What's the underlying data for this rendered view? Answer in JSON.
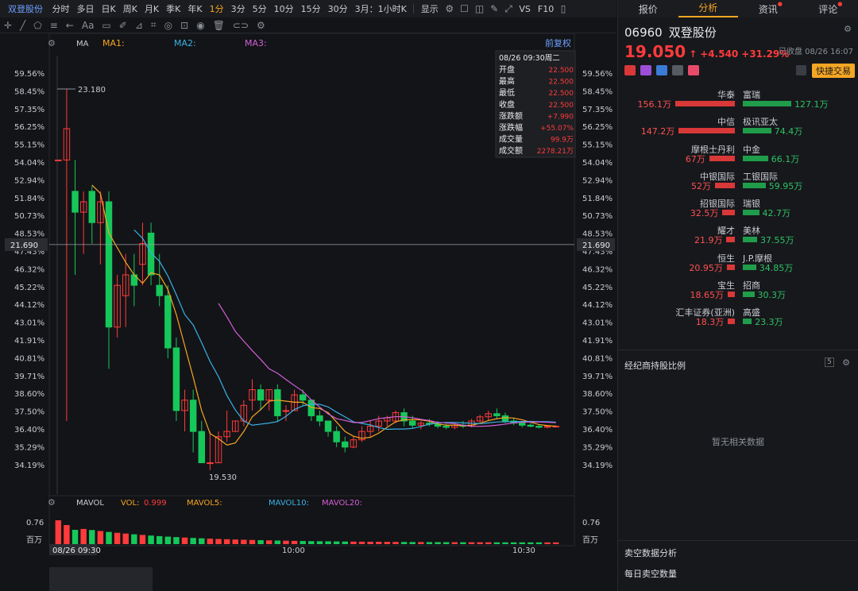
{
  "topbar": {
    "stock_name": "双登股份",
    "intervals": [
      "分时",
      "多日",
      "日K",
      "周K",
      "月K",
      "季K",
      "年K",
      "1分",
      "3分",
      "5分",
      "10分",
      "15分",
      "30分"
    ],
    "active_interval": "1分",
    "range": "3月：1小时K",
    "display": "显示",
    "vs": "VS",
    "f10": "F10"
  },
  "toolbar": {
    "icons": [
      "crosshair-icon",
      "line-icon",
      "shape-icon",
      "fib-icon",
      "arrow-icon",
      "text-icon",
      "note-icon",
      "pen-icon",
      "ruler-icon",
      "measure-icon",
      "magnet-icon",
      "lock-icon",
      "eye-icon",
      "trash-icon",
      "link-icon",
      "settings-icon"
    ]
  },
  "chart": {
    "ma_label": "MA",
    "ma1": "MA1:",
    "ma2": "MA2:",
    "ma3": "MA3:",
    "fuquan": "前复权",
    "high_label": "23.180",
    "low_label": "19.530",
    "cross_price": "21.690",
    "left_axis": [
      "59.56%",
      "58.45%",
      "57.35%",
      "56.25%",
      "55.15%",
      "54.04%",
      "52.94%",
      "51.84%",
      "50.73%",
      "48.53%",
      "47.43%",
      "46.32%",
      "45.22%",
      "44.12%",
      "43.01%",
      "41.91%",
      "40.81%",
      "39.71%",
      "38.60%",
      "37.50%",
      "36.40%",
      "35.29%",
      "34.19%"
    ],
    "tooltip": {
      "date": "08/26 09:30周二",
      "rows": [
        [
          "开盘",
          "22.500"
        ],
        [
          "最高",
          "22.500"
        ],
        [
          "最低",
          "22.500"
        ],
        [
          "收盘",
          "22.500"
        ],
        [
          "涨跌额",
          "+7.990"
        ],
        [
          "涨跌幅",
          "+55.07%"
        ],
        [
          "成交量",
          "99.9万"
        ],
        [
          "成交额",
          "2278.21万"
        ]
      ]
    },
    "vol": {
      "label": "MAVOL",
      "vol": "VOL:",
      "vol_val": "0.999",
      "mavol5": "MAVOL5:",
      "mavol10": "MAVOL10:",
      "mavol20": "MAVOL20:",
      "scale": "0.76",
      "unit": "百万"
    },
    "time_labels": [
      "08/26 09:30",
      "10:00",
      "10:30"
    ],
    "colors": {
      "up": "#ff3b3b",
      "down": "#16c75a",
      "ma1": "#f5a623",
      "ma2": "#3ab0e6",
      "ma3": "#d45fd8"
    }
  },
  "chart_data": {
    "type": "candlestick",
    "candles": [
      [
        22.5,
        22.5,
        22.5,
        22.5
      ],
      [
        22.5,
        23.18,
        20.0,
        22.8
      ],
      [
        22.2,
        22.5,
        21.4,
        22.0
      ],
      [
        22.0,
        22.2,
        21.6,
        22.1
      ],
      [
        22.2,
        22.25,
        21.7,
        21.9
      ],
      [
        21.9,
        22.2,
        21.5,
        22.1
      ],
      [
        22.1,
        22.2,
        20.5,
        20.9
      ],
      [
        20.9,
        21.4,
        20.8,
        21.3
      ],
      [
        21.2,
        21.6,
        20.9,
        21.4
      ],
      [
        21.4,
        21.6,
        21.1,
        21.3
      ],
      [
        21.5,
        21.9,
        21.3,
        21.7
      ],
      [
        21.8,
        21.9,
        21.3,
        21.4
      ],
      [
        21.3,
        21.6,
        21.1,
        21.2
      ],
      [
        21.2,
        21.3,
        20.6,
        20.7
      ],
      [
        20.7,
        20.8,
        20.0,
        20.1
      ],
      [
        20.1,
        20.3,
        19.9,
        20.2
      ],
      [
        20.2,
        20.3,
        19.7,
        19.9
      ],
      [
        19.9,
        20.0,
        19.8,
        19.6
      ],
      [
        19.6,
        19.9,
        19.53,
        19.6
      ],
      [
        19.6,
        19.9,
        19.6,
        19.85
      ],
      [
        19.85,
        20.1,
        19.8,
        19.9
      ],
      [
        19.9,
        20.0,
        19.9,
        20.0
      ],
      [
        20.0,
        20.2,
        19.95,
        20.15
      ],
      [
        20.2,
        20.4,
        20.1,
        20.3
      ],
      [
        20.3,
        20.35,
        20.1,
        20.2
      ],
      [
        20.2,
        20.3,
        20.1,
        20.3
      ],
      [
        20.3,
        20.35,
        20.0,
        20.05
      ],
      [
        20.1,
        20.15,
        20.0,
        20.1
      ],
      [
        20.1,
        20.3,
        20.1,
        20.25
      ],
      [
        20.25,
        20.3,
        20.15,
        20.2
      ],
      [
        20.2,
        20.2,
        20.0,
        20.05
      ],
      [
        20.05,
        20.1,
        19.95,
        20.0
      ],
      [
        20.0,
        20.0,
        19.85,
        19.9
      ],
      [
        19.9,
        19.95,
        19.75,
        19.8
      ],
      [
        19.8,
        19.85,
        19.7,
        19.75
      ],
      [
        19.75,
        19.85,
        19.74,
        19.82
      ],
      [
        19.82,
        19.95,
        19.8,
        19.9
      ],
      [
        19.9,
        20.0,
        19.85,
        19.95
      ],
      [
        19.95,
        20.05,
        19.9,
        20.0
      ],
      [
        20.0,
        20.05,
        19.95,
        20.03
      ],
      [
        20.0,
        20.1,
        19.98,
        20.08
      ],
      [
        20.08,
        20.12,
        19.95,
        20.0
      ],
      [
        20.0,
        20.05,
        19.93,
        19.96
      ],
      [
        19.96,
        20.0,
        19.92,
        19.98
      ],
      [
        19.98,
        20.02,
        19.95,
        19.97
      ],
      [
        19.97,
        20.0,
        19.93,
        19.95
      ],
      [
        19.95,
        19.98,
        19.92,
        19.94
      ],
      [
        19.94,
        19.98,
        19.92,
        19.96
      ],
      [
        19.96,
        20.0,
        19.93,
        19.95
      ],
      [
        19.95,
        20.02,
        19.94,
        20.0
      ],
      [
        20.0,
        20.06,
        19.98,
        20.04
      ],
      [
        20.04,
        20.1,
        20.0,
        20.07
      ],
      [
        20.07,
        20.12,
        20.02,
        20.05
      ],
      [
        20.05,
        20.08,
        19.98,
        20.0
      ],
      [
        20.0,
        20.03,
        19.96,
        19.98
      ],
      [
        19.98,
        20.0,
        19.94,
        19.96
      ],
      [
        19.96,
        19.98,
        19.94,
        19.95
      ],
      [
        19.95,
        19.97,
        19.93,
        19.94
      ],
      [
        19.94,
        19.96,
        19.93,
        19.95
      ],
      [
        19.95,
        19.96,
        19.94,
        19.95
      ]
    ],
    "ylim": [
      19.3,
      23.5
    ]
  },
  "right": {
    "tabs": [
      "报价",
      "分析",
      "资讯",
      "评论"
    ],
    "active_tab": "分析",
    "code": "06960",
    "name": "双登股份",
    "price": "19.050",
    "change": "+4.540",
    "pct": "+31.29%",
    "closed": "已收盘 08/26 16:07",
    "quick_trade": "快捷交易",
    "brokers": [
      [
        "华泰",
        "156.1万",
        "富瑞",
        "127.1万",
        156.1,
        127.1
      ],
      [
        "中信",
        "147.2万",
        "极讯亚太",
        "74.4万",
        147.2,
        74.4
      ],
      [
        "摩根士丹利",
        "67万",
        "中金",
        "66.1万",
        67,
        66.1
      ],
      [
        "中银国际",
        "52万",
        "工银国际",
        "59.95万",
        52,
        59.95
      ],
      [
        "招银国际",
        "32.5万",
        "瑞银",
        "42.7万",
        32.5,
        42.7
      ],
      [
        "耀才",
        "21.9万",
        "美林",
        "37.55万",
        21.9,
        37.55
      ],
      [
        "恒生",
        "20.95万",
        "J.P.摩根",
        "34.85万",
        20.95,
        34.85
      ],
      [
        "宝生",
        "18.65万",
        "招商",
        "30.3万",
        18.65,
        30.3
      ],
      [
        "汇丰证券(亚洲)",
        "18.3万",
        "高盛",
        "23.3万",
        18.3,
        23.3
      ]
    ],
    "holding_title": "经纪商持股比例",
    "no_data": "暂无相关数据",
    "short_title": "卖空数据分析",
    "short_qty": "每日卖空数量"
  }
}
